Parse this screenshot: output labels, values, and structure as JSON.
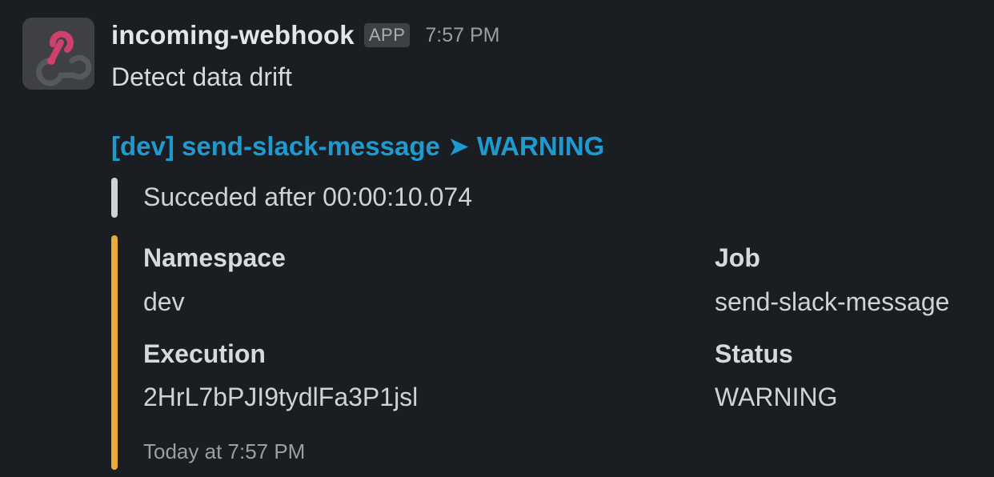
{
  "message": {
    "sender": "incoming-webhook",
    "badge": "APP",
    "time": "7:57 PM",
    "text": "Detect data drift",
    "avatar_icon": "webhook-icon"
  },
  "attachment": {
    "title": "[dev] send-slack-message ➤ WARNING",
    "status_text": "Succeded after 00:00:10.074",
    "accent_color": "#e8ac3a",
    "fields": [
      {
        "label": "Namespace",
        "value": "dev"
      },
      {
        "label": "Job",
        "value": "send-slack-message"
      },
      {
        "label": "Execution",
        "value": "2HrL7bPJI9tydlFa3P1jsl"
      },
      {
        "label": "Status",
        "value": "WARNING"
      }
    ],
    "footer": "Today at 7:57 PM"
  },
  "colors": {
    "background": "#1a1d21",
    "link": "#1d9bd1",
    "warning_bar": "#e8ac3a",
    "neutral_bar": "#d1d2d3"
  }
}
